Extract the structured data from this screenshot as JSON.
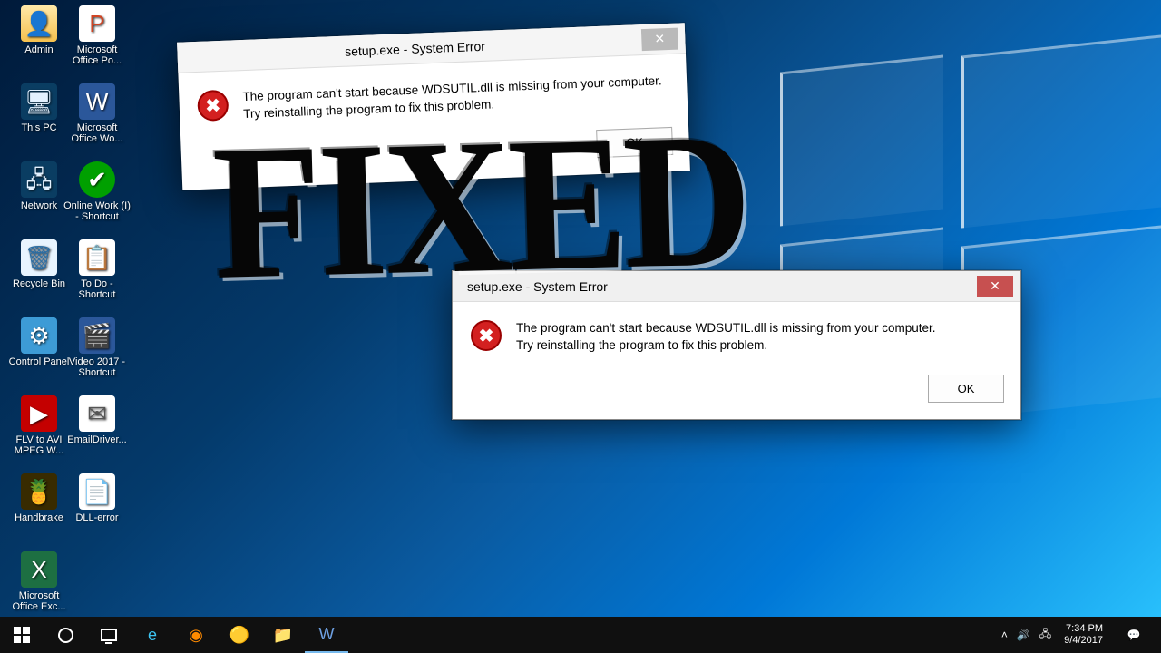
{
  "overlay_text": "FIXED",
  "icons": {
    "r0c0": "Admin",
    "r0c1": "Microsoft Office Po...",
    "r1c0": "This PC",
    "r1c1": "Microsoft Office Wo...",
    "r2c0": "Network",
    "r2c1": "Online Work (I) - Shortcut",
    "r3c0": "Recycle Bin",
    "r3c1": "To Do - Shortcut",
    "r4c0": "Control Panel",
    "r4c1": "Video 2017 - Shortcut",
    "r5c0": "FLV to AVI MPEG W...",
    "r5c1": "EmailDriver...",
    "r6c0": "Handbrake",
    "r6c1": "DLL-error",
    "r7c0": "Microsoft Office Exc..."
  },
  "dialog_back": {
    "title": "setup.exe - System Error",
    "message": "The program can't start because WDSUTIL.dll is missing from your computer. Try reinstalling the program to fix this problem.",
    "ok": "OK"
  },
  "dialog_front": {
    "title": "setup.exe - System Error",
    "message": "The program can't start because WDSUTIL.dll is missing from your computer. Try reinstalling the program to fix this problem.",
    "ok": "OK"
  },
  "taskbar": {
    "time": "7:34 PM",
    "date": "9/4/2017"
  }
}
